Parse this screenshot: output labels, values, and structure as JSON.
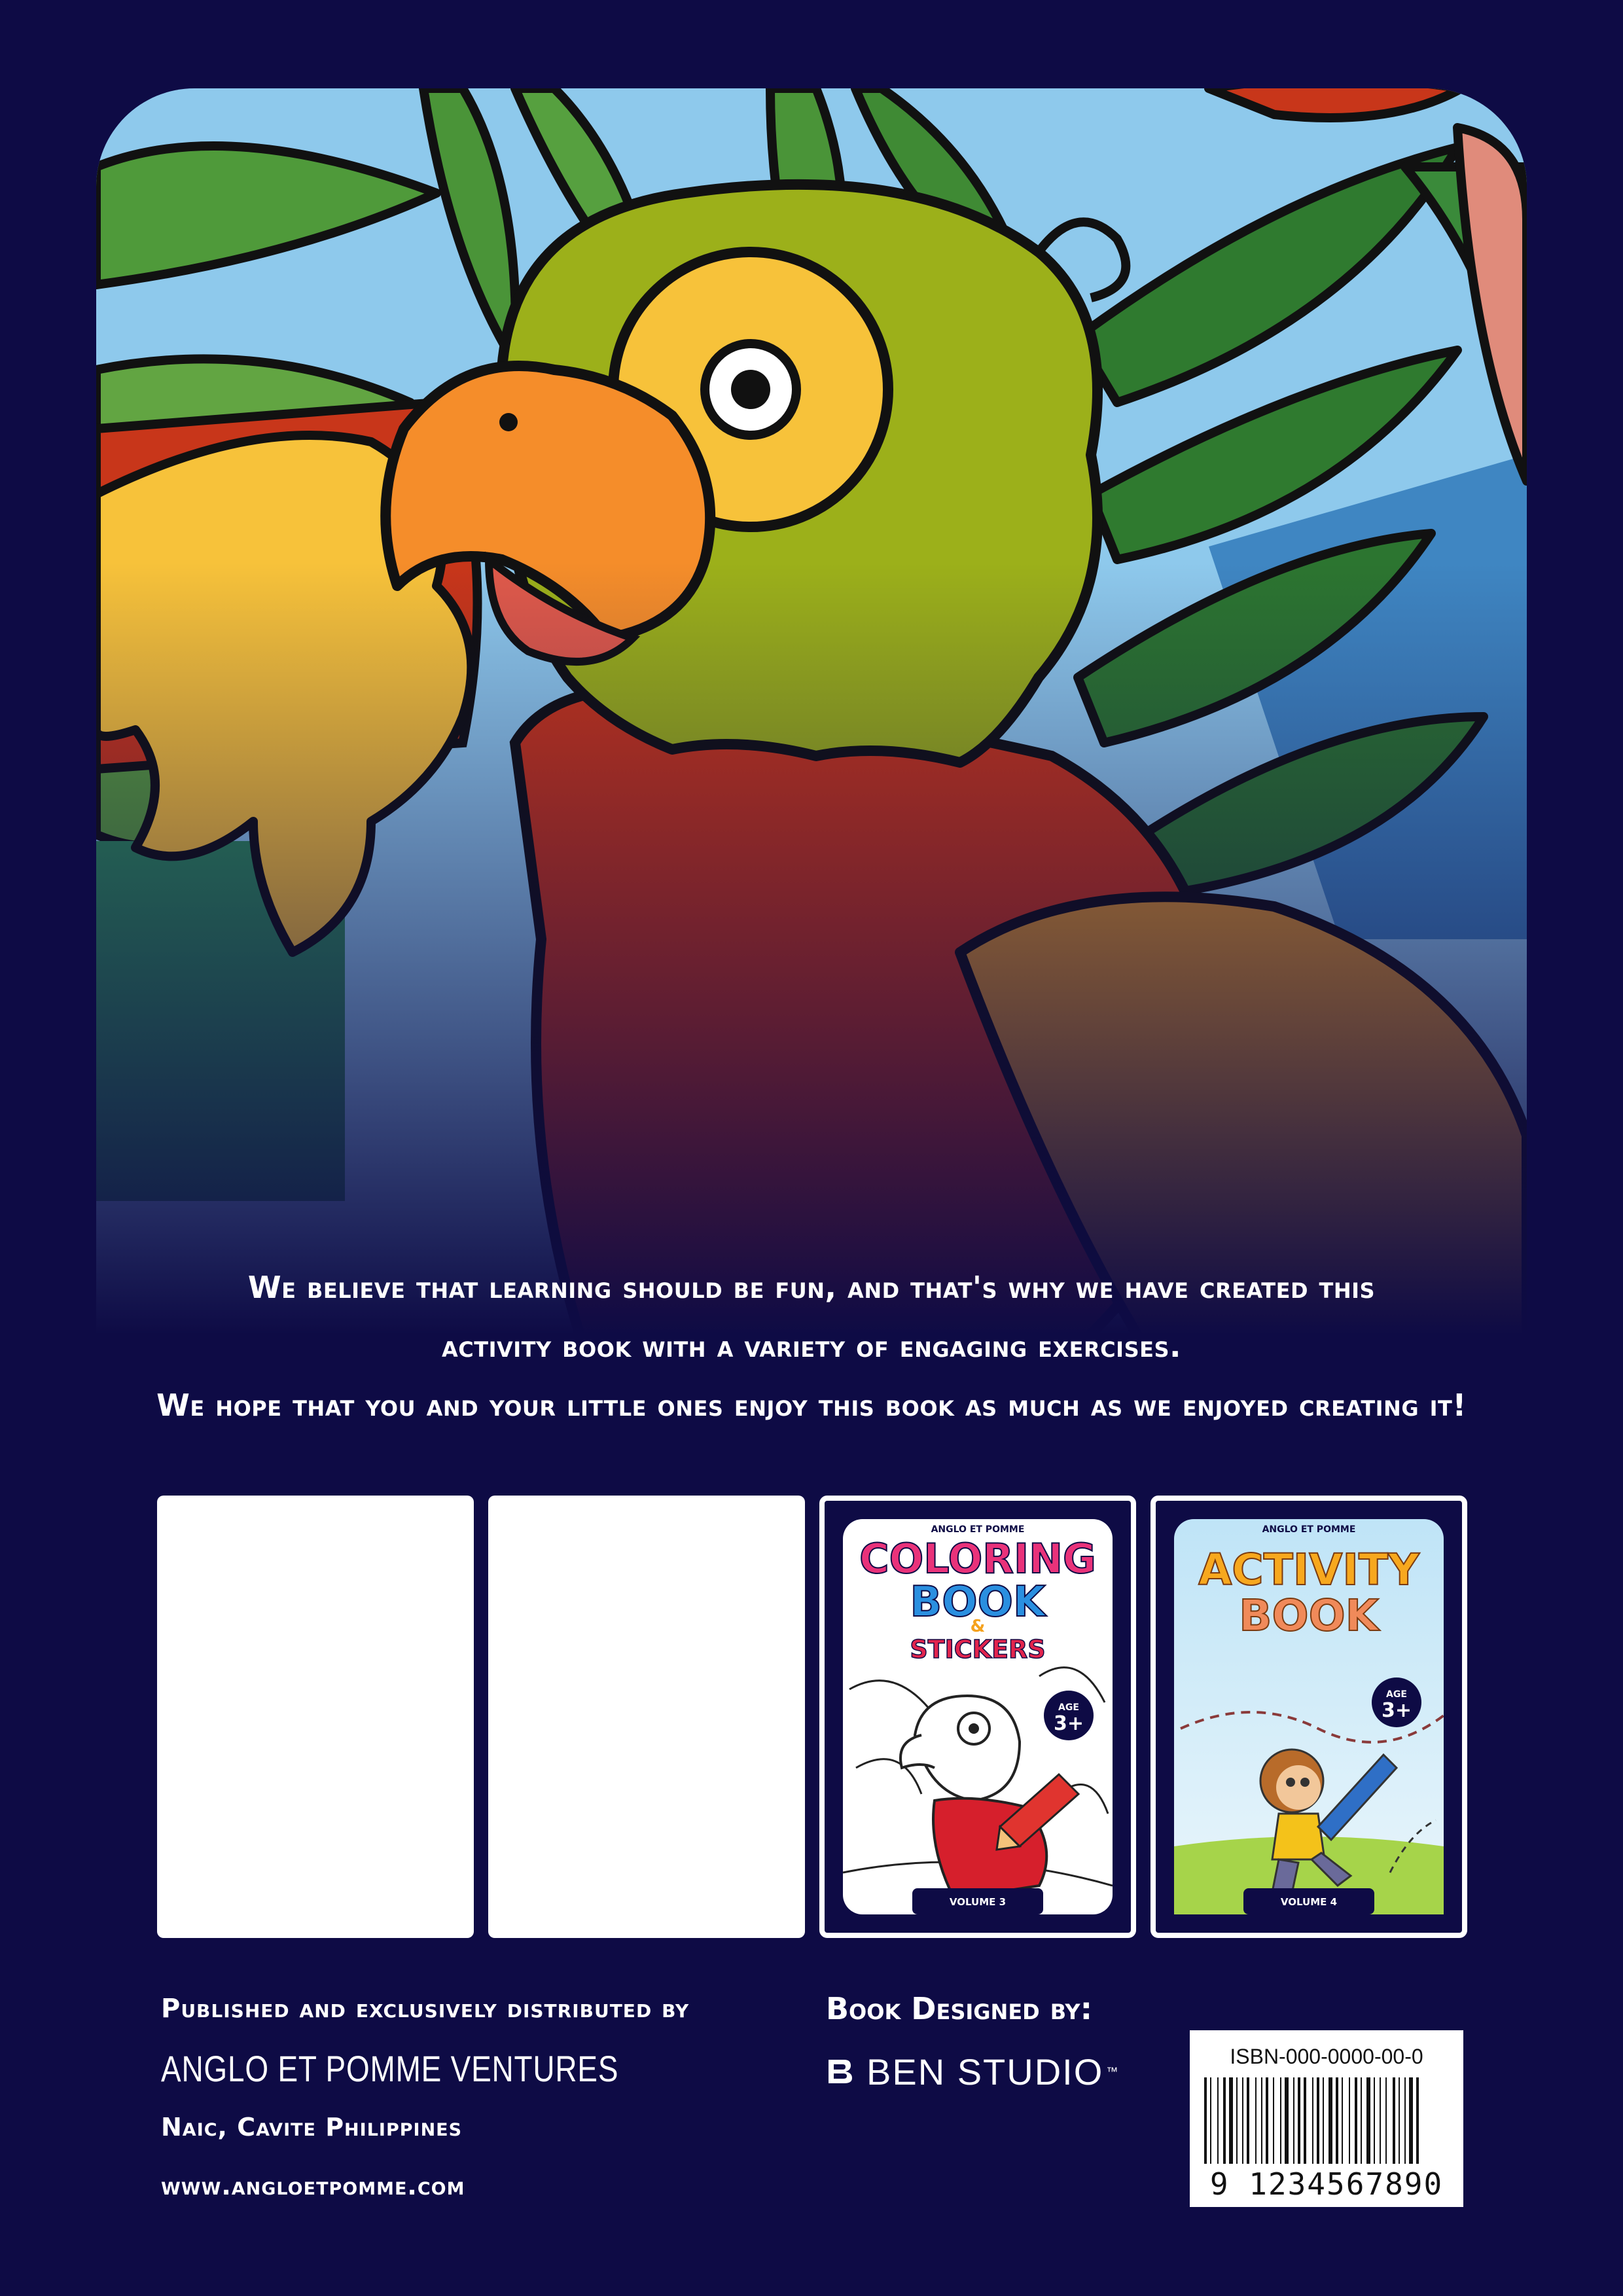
{
  "tagline": [
    "We believe that learning should be fun, and that's why we have created this",
    "activity book with a variety of engaging exercises.",
    "We hope that you and your little ones enjoy this book as much as we enjoyed creating it!"
  ],
  "books": [
    {
      "brand": "ANGLO ET POMME",
      "title_lines": [
        "COLORING",
        "BOOK",
        "&",
        "STICKERS"
      ],
      "age_label": "AGE",
      "age_value": "3+",
      "volume": "VOLUME 3"
    },
    {
      "brand": "ANGLO ET POMME",
      "title_lines": [
        "ACTIVITY",
        "BOOK"
      ],
      "age_label": "AGE",
      "age_value": "3+",
      "volume": "VOLUME 4"
    }
  ],
  "publisher": {
    "label": "Published and exclusively distributed by",
    "name": "ANGLO ET POMME VENTURES",
    "location": "Naic, Cavite Philippines",
    "website": "www.angloetpomme.com"
  },
  "designer": {
    "label": "Book Designed by:",
    "studio": "BEN STUDIO",
    "trademark": "™"
  },
  "barcode": {
    "isbn": "ISBN-000-0000-00-0",
    "digits": "9 1234567890"
  },
  "colors": {
    "background": "#0e0b45",
    "sky": "#8ec9ec",
    "leaf": "#3a8a3a",
    "parrot_head": "#9cb01a",
    "parrot_body": "#c8361a",
    "wing": "#f7c23a",
    "beak": "#f58d2a"
  }
}
